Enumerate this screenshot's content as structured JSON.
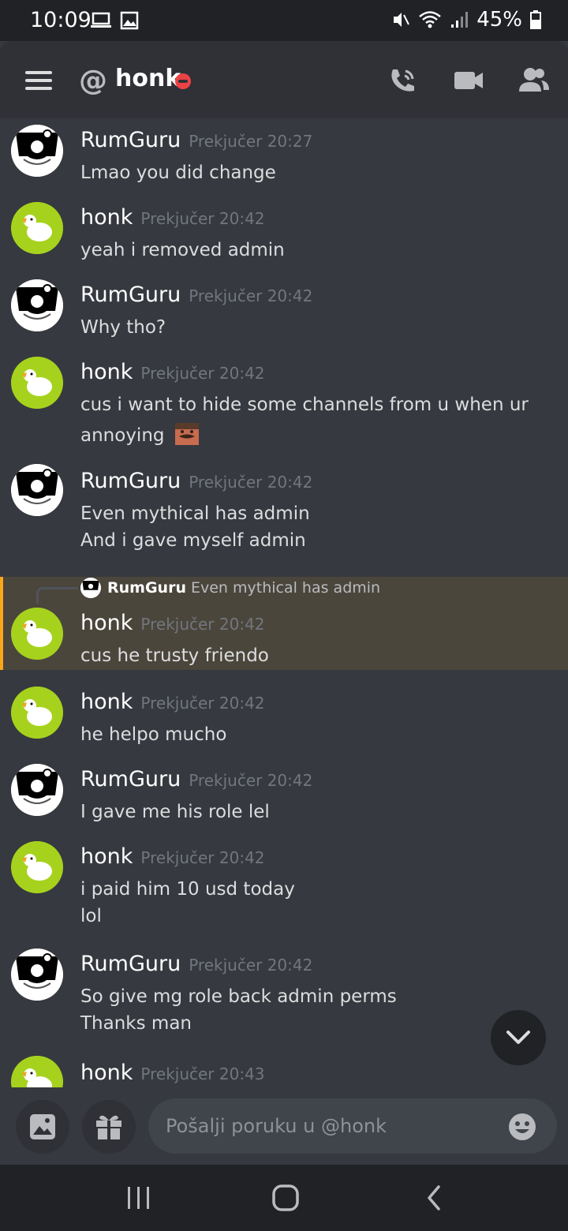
{
  "status_bar": {
    "time": "10:09",
    "battery": "45%"
  },
  "header": {
    "at_symbol": "@",
    "channel_name": "honk"
  },
  "messages": [
    {
      "author": "RumGuru",
      "timestamp": "Prekjučer 20:27",
      "lines": [
        "Lmao you did change"
      ],
      "avatar": "astronaut-avatar"
    },
    {
      "author": "honk",
      "timestamp": "Prekjučer 20:42",
      "lines": [
        "yeah i removed admin"
      ],
      "avatar": "goose-avatar"
    },
    {
      "author": "RumGuru",
      "timestamp": "Prekjučer 20:42",
      "lines": [
        "Why tho?"
      ],
      "avatar": "astronaut-avatar"
    },
    {
      "author": "honk",
      "timestamp": "Prekjučer 20:42",
      "lines": [
        "cus i want to hide some channels from u when ur",
        "annoying"
      ],
      "avatar": "goose-avatar",
      "emoji": "mustache-face-emoji"
    },
    {
      "author": "RumGuru",
      "timestamp": "Prekjučer 20:42",
      "lines": [
        "Even mythical has admin",
        "And i gave myself admin"
      ],
      "avatar": "astronaut-avatar"
    },
    {
      "author": "honk",
      "timestamp": "Prekjučer 20:42",
      "lines": [
        "cus he trusty friendo"
      ],
      "avatar": "goose-avatar",
      "reply": {
        "author": "RumGuru",
        "text": "Even mythical has admin"
      },
      "highlighted": true
    },
    {
      "author": "honk",
      "timestamp": "Prekjučer 20:42",
      "lines": [
        "he helpo mucho"
      ],
      "avatar": "goose-avatar"
    },
    {
      "author": "RumGuru",
      "timestamp": "Prekjučer 20:42",
      "lines": [
        "I gave me his role lel"
      ],
      "avatar": "astronaut-avatar"
    },
    {
      "author": "honk",
      "timestamp": "Prekjučer 20:42",
      "lines": [
        "i paid him 10 usd today",
        "lol"
      ],
      "avatar": "goose-avatar"
    },
    {
      "author": "RumGuru",
      "timestamp": "Prekjučer 20:42",
      "lines": [
        "So give mg role back admin perms",
        "Thanks man"
      ],
      "avatar": "astronaut-avatar"
    },
    {
      "author": "honk",
      "timestamp": "Prekjučer 20:43",
      "lines": [],
      "avatar": "goose-avatar"
    }
  ],
  "composer": {
    "placeholder": "Pošalji poruku u @honk"
  },
  "colors": {
    "background": "#36393f",
    "header": "#2f3136",
    "accent_highlight": "#faa61a",
    "dnd_status": "#ed4245",
    "goose_avatar_bg": "#a6d21e"
  }
}
